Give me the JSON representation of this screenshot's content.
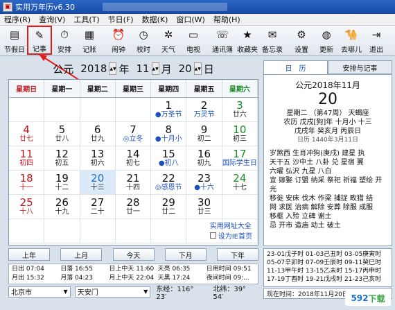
{
  "window": {
    "title": "实用万年历v6.30"
  },
  "menu": [
    "程序(R)",
    "查询(V)",
    "工具(T)",
    "节日(F)",
    "数据(K)",
    "窗口(W)",
    "帮助(H)"
  ],
  "toolbar": [
    {
      "label": "节假日",
      "icon": "holiday-icon",
      "glyph": "▤"
    },
    {
      "label": "记事",
      "icon": "notes-icon",
      "glyph": "✎"
    },
    {
      "label": "安排",
      "icon": "schedule-icon",
      "glyph": "⏱"
    },
    {
      "label": "记账",
      "icon": "ledger-icon",
      "glyph": "▦"
    },
    {
      "label": "闹钟",
      "icon": "alarm-clock-icon",
      "glyph": "⏰"
    },
    {
      "label": "校时",
      "icon": "time-sync-icon",
      "glyph": "◷"
    },
    {
      "label": "天气",
      "icon": "weather-icon",
      "glyph": "✲"
    },
    {
      "label": "电视",
      "icon": "tv-icon",
      "glyph": "▭"
    },
    {
      "label": "通讯簿",
      "icon": "address-book-icon",
      "glyph": "☏"
    },
    {
      "label": "收藏夹",
      "icon": "favorites-star-icon",
      "glyph": "★"
    },
    {
      "label": "备忘录",
      "icon": "memo-icon",
      "glyph": "✉"
    },
    {
      "label": "设置",
      "icon": "settings-icon",
      "glyph": "⚙"
    },
    {
      "label": "更新",
      "icon": "update-globe-icon",
      "glyph": "◍"
    },
    {
      "label": "去哪儿",
      "icon": "qunar-camel-icon",
      "glyph": "🐪"
    },
    {
      "label": "退出",
      "icon": "exit-door-icon",
      "glyph": "⇥"
    }
  ],
  "header": {
    "era": "公元",
    "year": "2018",
    "year_unit": "年",
    "month": "11",
    "month_unit": "月",
    "day": "20",
    "day_unit": "日"
  },
  "weekdays": [
    "星期日",
    "星期一",
    "星期二",
    "星期三",
    "星期四",
    "星期五",
    "星期六"
  ],
  "calendar_cells": [
    {
      "d": "",
      "s": ""
    },
    {
      "d": "",
      "s": ""
    },
    {
      "d": "",
      "s": ""
    },
    {
      "d": "",
      "s": ""
    },
    {
      "d": "1",
      "s": "●万圣节",
      "sc": "blue"
    },
    {
      "d": "2",
      "s": "万灵节",
      "sc": "blue"
    },
    {
      "d": "3",
      "s": "廿六",
      "c": "green"
    },
    {
      "d": "4",
      "s": "廿七",
      "c": "red"
    },
    {
      "d": "5",
      "s": "廿八"
    },
    {
      "d": "6",
      "s": "廿九"
    },
    {
      "d": "7",
      "s": "◎立冬",
      "sc": "blue"
    },
    {
      "d": "8",
      "s": "●十月小",
      "sc": "blue"
    },
    {
      "d": "9",
      "s": "初二"
    },
    {
      "d": "10",
      "s": "初三",
      "c": "green"
    },
    {
      "d": "11",
      "s": "初四",
      "c": "red"
    },
    {
      "d": "12",
      "s": "初五"
    },
    {
      "d": "13",
      "s": "初六"
    },
    {
      "d": "14",
      "s": "初七"
    },
    {
      "d": "15",
      "s": "●初八",
      "sc": "blue"
    },
    {
      "d": "16",
      "s": "初九"
    },
    {
      "d": "17",
      "s": "国际学生日",
      "c": "green",
      "sc": "blue"
    },
    {
      "d": "18",
      "s": "十一",
      "c": "red"
    },
    {
      "d": "19",
      "s": "十二"
    },
    {
      "d": "20",
      "s": "十三",
      "today": true
    },
    {
      "d": "21",
      "s": "十四"
    },
    {
      "d": "22",
      "s": "◎感恩节",
      "sc": "blue"
    },
    {
      "d": "23",
      "s": "●十六",
      "sc": "blue"
    },
    {
      "d": "24",
      "s": "十七",
      "c": "green"
    },
    {
      "d": "25",
      "s": "十八",
      "c": "red"
    },
    {
      "d": "26",
      "s": "十九"
    },
    {
      "d": "27",
      "s": "二十"
    },
    {
      "d": "28",
      "s": "廿一"
    },
    {
      "d": "29",
      "s": "廿二"
    },
    {
      "d": "30",
      "s": "廿三"
    },
    {
      "d": "",
      "s": ""
    },
    {
      "d": "",
      "s": ""
    },
    {
      "d": "",
      "s": ""
    },
    {
      "d": "",
      "s": ""
    },
    {
      "d": "",
      "s": ""
    },
    {
      "d": "",
      "s": ""
    },
    {
      "d": "",
      "s": ""
    },
    {
      "d": "",
      "s": ""
    }
  ],
  "links": {
    "site": "实用网址大全",
    "homepage": "设为IE首页"
  },
  "nav": {
    "prev_year": "上年",
    "prev_month": "上月",
    "today": "今天",
    "next_month": "下月",
    "next_year": "下年"
  },
  "sun_info": [
    "日出 07:04",
    "日落 16:55",
    "日上中天 11:60",
    "天亮 06:35",
    "日用时间 09:51",
    "月出 15:32",
    "月落 04:23",
    "月上中天 22:04",
    "天黑 17:24",
    "夜间时间 09:..."
  ],
  "location": {
    "city": "北京市",
    "district": "天安门",
    "longitude": "东经：116° 23′",
    "latitude": "北纬：39° 54′"
  },
  "right_tabs": {
    "day": "日　历",
    "schedule": "安排与记事"
  },
  "day_detail": {
    "year_month": "公元2018年11月",
    "day": "20",
    "week_line": "星期二 （第47周） 天蝎座",
    "lunar_line": "农历 戊戌[狗]年 十月小 十三",
    "ganzhi_line": "戊戌年 癸亥月 丙辰日",
    "calendar_line": "日历 1440年3月11日",
    "almanac": [
      "岁煞西 生肖冲狗(庚戌) 建星 执",
      "天干五 沙中土 八卦 兑 星宿 翼",
      "六曜 弘沢 九星 八白",
      "宜 嫁娶 订盟 纳采 祭祀 祈福 塑绘 开光",
      "移徙 安床 伐木 作梁 捕捉 畋猎 结",
      "网 求医 治病 解除 安葬 除服 成服",
      "移柩 入殓 立碑 谢土",
      "忌 开市 造庙 动土 破土"
    ]
  },
  "solar_terms": [
    "23-01戊子时 01-03己丑时 03-05庚寅时",
    "05-07辛卯时 07-09壬辰时 09-11癸巳时",
    "11-13甲午时 13-15乙未时 15-17丙申时",
    "17-19丁酉时 19-21戊戌时 21-23己亥时"
  ],
  "now_line": "现在时间：2018年11月20日 ...",
  "watermark": {
    "num": "592",
    "text": "下载"
  }
}
